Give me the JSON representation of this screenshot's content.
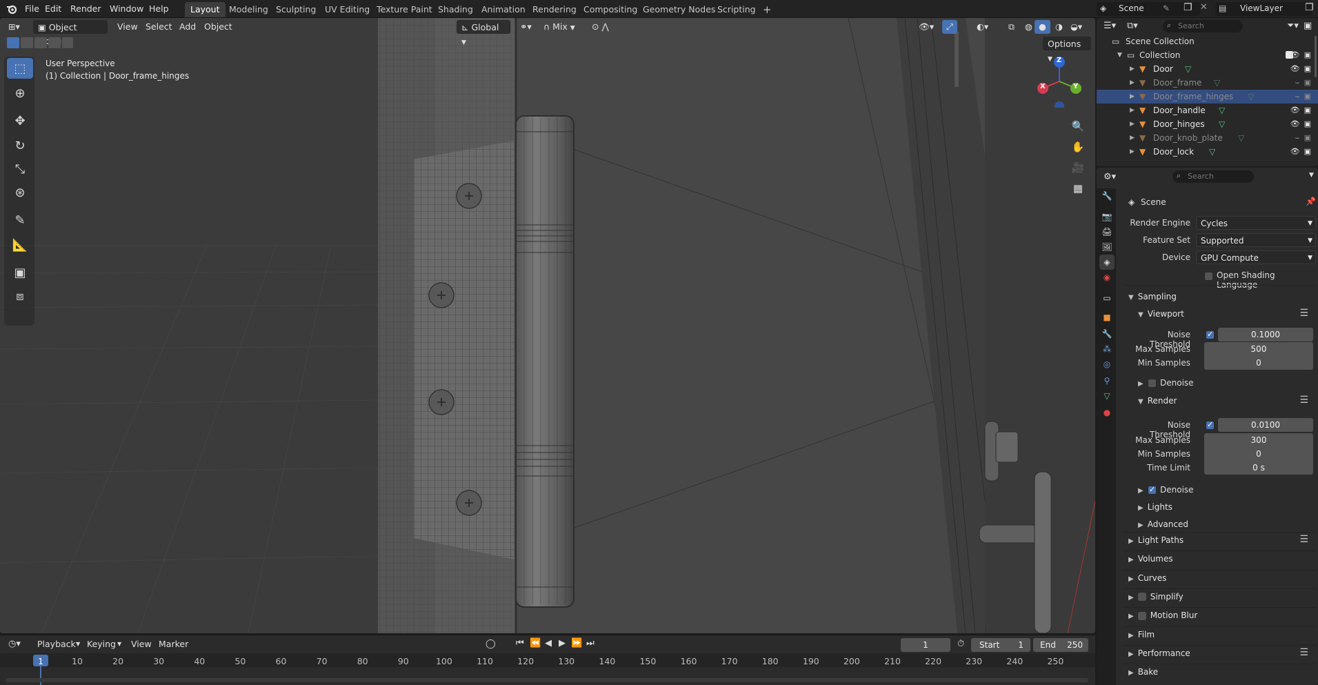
{
  "topbar": {
    "menus": [
      "File",
      "Edit",
      "Render",
      "Window",
      "Help"
    ],
    "workspaces": [
      "Layout",
      "Modeling",
      "Sculpting",
      "UV Editing",
      "Texture Paint",
      "Shading",
      "Animation",
      "Rendering",
      "Compositing",
      "Geometry Nodes",
      "Scripting"
    ],
    "active_workspace": "Layout",
    "add_tab": "+",
    "scene_name": "Scene",
    "view_layer": "ViewLayer"
  },
  "viewport": {
    "mode": "Object Mode",
    "menus": [
      "View",
      "Select",
      "Add",
      "Object"
    ],
    "orientation": "Global",
    "snap_mode": "Mix",
    "options_label": "Options",
    "overlay_line1": "User Perspective",
    "overlay_line2": "(1) Collection | Door_frame_hinges",
    "gizmo": {
      "x": "X",
      "y": "Y",
      "z": "Z"
    }
  },
  "timeline": {
    "menus": [
      "Playback",
      "Keying",
      "View",
      "Marker"
    ],
    "current_frame": "1",
    "start_label": "Start",
    "start": "1",
    "end_label": "End",
    "end": "250",
    "ticks": [
      "1",
      "10",
      "20",
      "30",
      "40",
      "50",
      "60",
      "70",
      "80",
      "90",
      "100",
      "110",
      "120",
      "130",
      "140",
      "150",
      "160",
      "170",
      "180",
      "190",
      "200",
      "210",
      "220",
      "230",
      "240",
      "250"
    ]
  },
  "outliner": {
    "search_placeholder": "Search",
    "scene_collection": "Scene Collection",
    "collection": "Collection",
    "objects": [
      {
        "name": "Door",
        "visible": true,
        "selected": false
      },
      {
        "name": "Door_frame",
        "visible": false,
        "selected": false
      },
      {
        "name": "Door_frame_hinges",
        "visible": false,
        "selected": true
      },
      {
        "name": "Door_handle",
        "visible": true,
        "selected": false
      },
      {
        "name": "Door_hinges",
        "visible": true,
        "selected": false
      },
      {
        "name": "Door_knob_plate",
        "visible": false,
        "selected": false
      },
      {
        "name": "Door_lock",
        "visible": true,
        "selected": false
      }
    ]
  },
  "properties": {
    "search_placeholder": "Search",
    "context": "Scene",
    "render_engine_label": "Render Engine",
    "render_engine": "Cycles",
    "feature_set_label": "Feature Set",
    "feature_set": "Supported",
    "device_label": "Device",
    "device": "GPU Compute",
    "osl_label": "Open Shading Language",
    "sampling": "Sampling",
    "viewport_sec": "Viewport",
    "vp_noise_label": "Noise Threshold",
    "vp_noise": "0.1000",
    "vp_max_label": "Max Samples",
    "vp_max": "500",
    "vp_min_label": "Min Samples",
    "vp_min": "0",
    "vp_denoise": "Denoise",
    "render_sec": "Render",
    "r_noise_label": "Noise Threshold",
    "r_noise": "0.0100",
    "r_max_label": "Max Samples",
    "r_max": "300",
    "r_min_label": "Min Samples",
    "r_min": "0",
    "r_time_label": "Time Limit",
    "r_time": "0 s",
    "r_denoise": "Denoise",
    "lights": "Lights",
    "advanced": "Advanced",
    "panels": [
      "Light Paths",
      "Volumes",
      "Curves",
      "Simplify",
      "Motion Blur",
      "Film",
      "Performance",
      "Bake"
    ]
  },
  "colors": {
    "accent": "#4772b3",
    "selected_row": "#334d80",
    "mesh_icon": "#e7913c",
    "data_icon": "#5fc18b"
  }
}
